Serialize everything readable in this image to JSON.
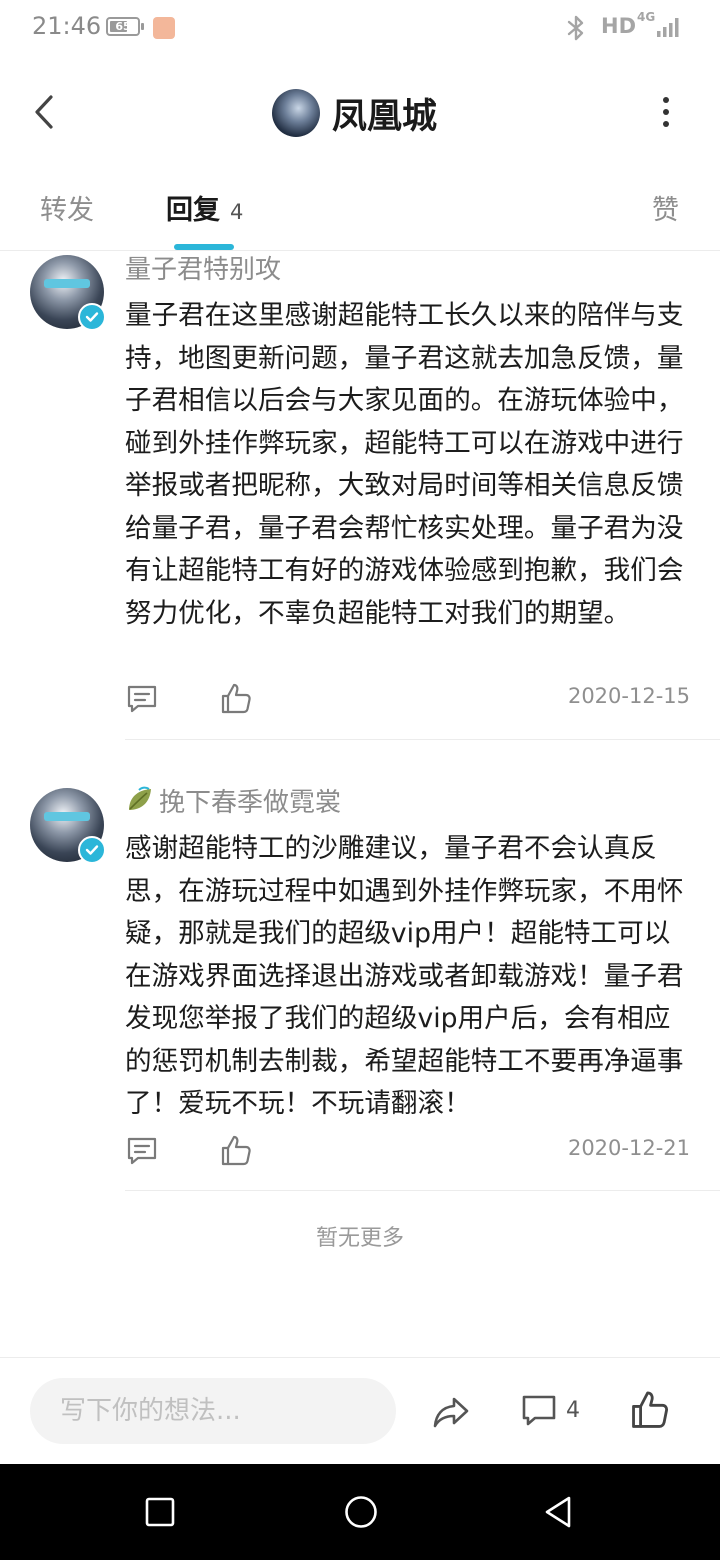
{
  "status_bar": {
    "time": "21:46",
    "battery": "65",
    "battery_level": 0.65,
    "hd_label": "HD",
    "network": "4G"
  },
  "header": {
    "title": "凤凰城"
  },
  "tabs": {
    "forward": "转发",
    "reply": "回复",
    "reply_count": "4",
    "like": "赞",
    "active": "reply"
  },
  "comments": [
    {
      "author": "量子君特别攻",
      "text": "量子君在这里感谢超能特工长久以来的陪伴与支持，地图更新问题，量子君这就去加急反馈，量子君相信以后会与大家见面的。在游玩体验中，碰到外挂作弊玩家，超能特工可以在游戏中进行举报或者把昵称，大致对局时间等相关信息反馈给量子君，量子君会帮忙核实处理。量子君为没有让超能特工有好的游戏体验感到抱歉，我们会努力优化，不辜负超能特工对我们的期望。",
      "date": "2020-12-15"
    },
    {
      "author": "挽下春季做霓裳",
      "text": "感谢超能特工的沙雕建议，量子君不会认真反思，在游玩过程中如遇到外挂作弊玩家，不用怀疑，那就是我们的超级vip用户！超能特工可以在游戏界面选择退出游戏或者卸载游戏！量子君发现您举报了我们的超级vip用户后，会有相应的惩罚机制去制裁，希望超能特工不要再净逼事了！爱玩不玩！不玩请翻滚！",
      "date": "2020-12-21"
    }
  ],
  "no_more": "暂无更多",
  "bottom_bar": {
    "input_placeholder": "写下你的想法...",
    "comment_count": "4"
  }
}
